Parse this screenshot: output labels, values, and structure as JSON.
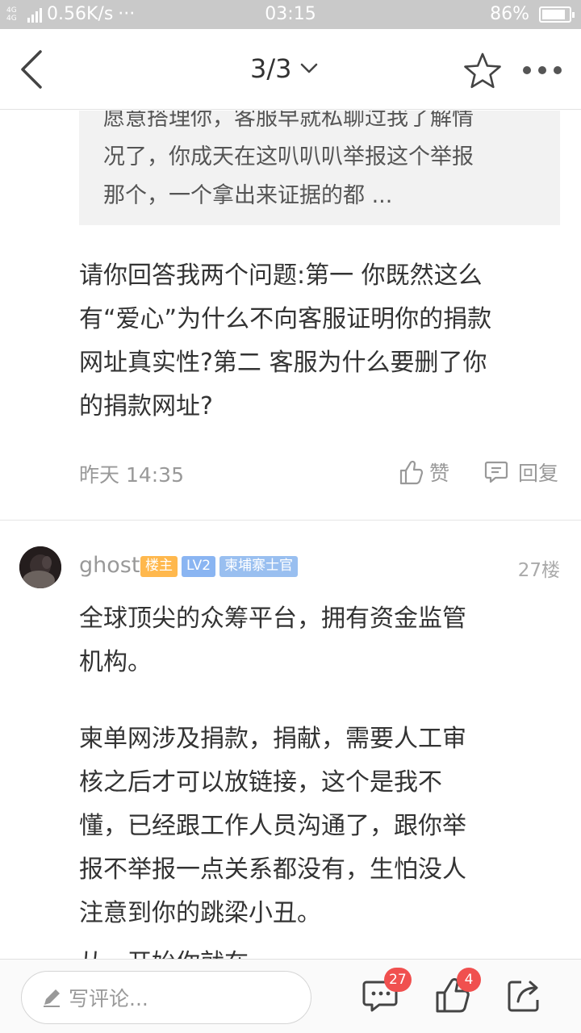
{
  "status_bar": {
    "network": "4G 4G",
    "speed": "0.56K/s",
    "dots": "···",
    "time": "03:15",
    "battery": "86%",
    "battery_level": 0.86
  },
  "nav": {
    "pager": "3/3"
  },
  "quoted": {
    "lines": [
      "愿意搭理你，客服早就私聊过我了解情",
      "况了，你成天在这叭叭叭举报这个举报",
      "那个，一个拿出来证据的都 ..."
    ]
  },
  "reply": {
    "lines": [
      "请你回答我两个问题:第一 你既然这么",
      "有“爱心”为什么不向客服证明你的捐款",
      "网址真实性?第二 客服为什么要删了你",
      "的捐款网址?"
    ],
    "time": "昨天 14:35",
    "like_label": "赞",
    "reply_label": "回复"
  },
  "floor": {
    "user": "ghost",
    "badge_host": "楼主",
    "badge_level": "LV2",
    "badge_title": "柬埔寨士官",
    "floor_number": "27楼",
    "para1": [
      "全球顶尖的众筹平台，拥有资金监管",
      "机构。"
    ],
    "para2": [
      "柬单网涉及捐款，捐献，需要人工审",
      "核之后才可以放链接，这个是我不",
      "懂，已经跟工作人员沟通了，跟你举",
      "报不举报一点关系都没有，生怕没人",
      "注意到你的跳梁小丑。"
    ],
    "para3_partial": "从一开始你就在…"
  },
  "bottom": {
    "comment_placeholder": "写评论...",
    "comment_count": "27",
    "like_count": "4"
  }
}
